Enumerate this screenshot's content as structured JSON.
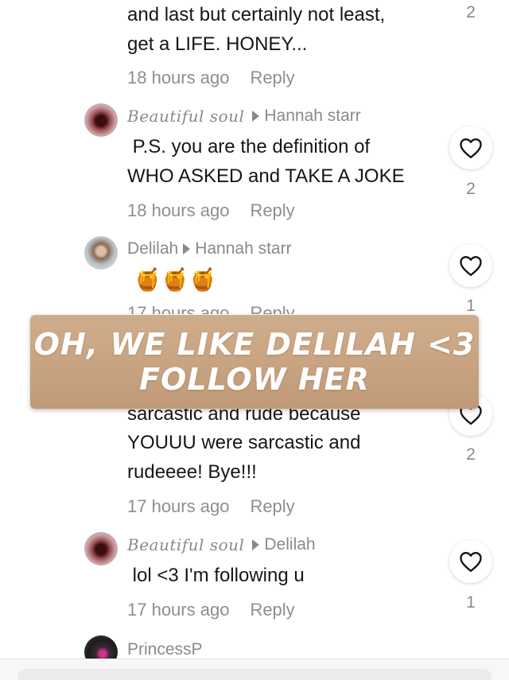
{
  "comments": [
    {
      "lines": [
        "and last but certainly not least,",
        "get a LIFE. HONEY..."
      ],
      "time": "18 hours ago",
      "reply_label": "Reply",
      "likes": "2"
    },
    {
      "author": "Beautiful soul",
      "reply_to": "Hannah starr",
      "lines": [
        " P.S. you are the definition of",
        "WHO ASKED and TAKE A JOKE"
      ],
      "time": "18 hours ago",
      "reply_label": "Reply",
      "likes": "2",
      "avatar_icon": "heart-avatar"
    },
    {
      "author": "Delilah",
      "reply_to": "Hannah starr",
      "emoji": "🍯🍯🍯",
      "time": "17 hours ago",
      "reply_label": "Reply",
      "likes": "1",
      "avatar_icon": "person-avatar"
    },
    {
      "lines": [
        "sarcastic and rude because",
        "YOUUU were sarcastic and",
        "rudeeee! Bye!!!"
      ],
      "time": "17 hours ago",
      "reply_label": "Reply",
      "likes": "2"
    },
    {
      "author": "Beautiful soul",
      "reply_to": "Delilah",
      "lines": [
        " lol <3 I'm following u"
      ],
      "time": "17 hours ago",
      "reply_label": "Reply",
      "likes": "1",
      "avatar_icon": "heart-avatar"
    },
    {
      "author": "PrincessP",
      "avatar_icon": "princess-avatar"
    }
  ],
  "banner": {
    "line1": "OH, WE LIKE DELILAH <3",
    "line2": "FOLLOW HER",
    "color": "#c8a482"
  },
  "icons": {
    "like": "heart-outline-icon",
    "reply_arrow": "triangle-right-icon"
  }
}
